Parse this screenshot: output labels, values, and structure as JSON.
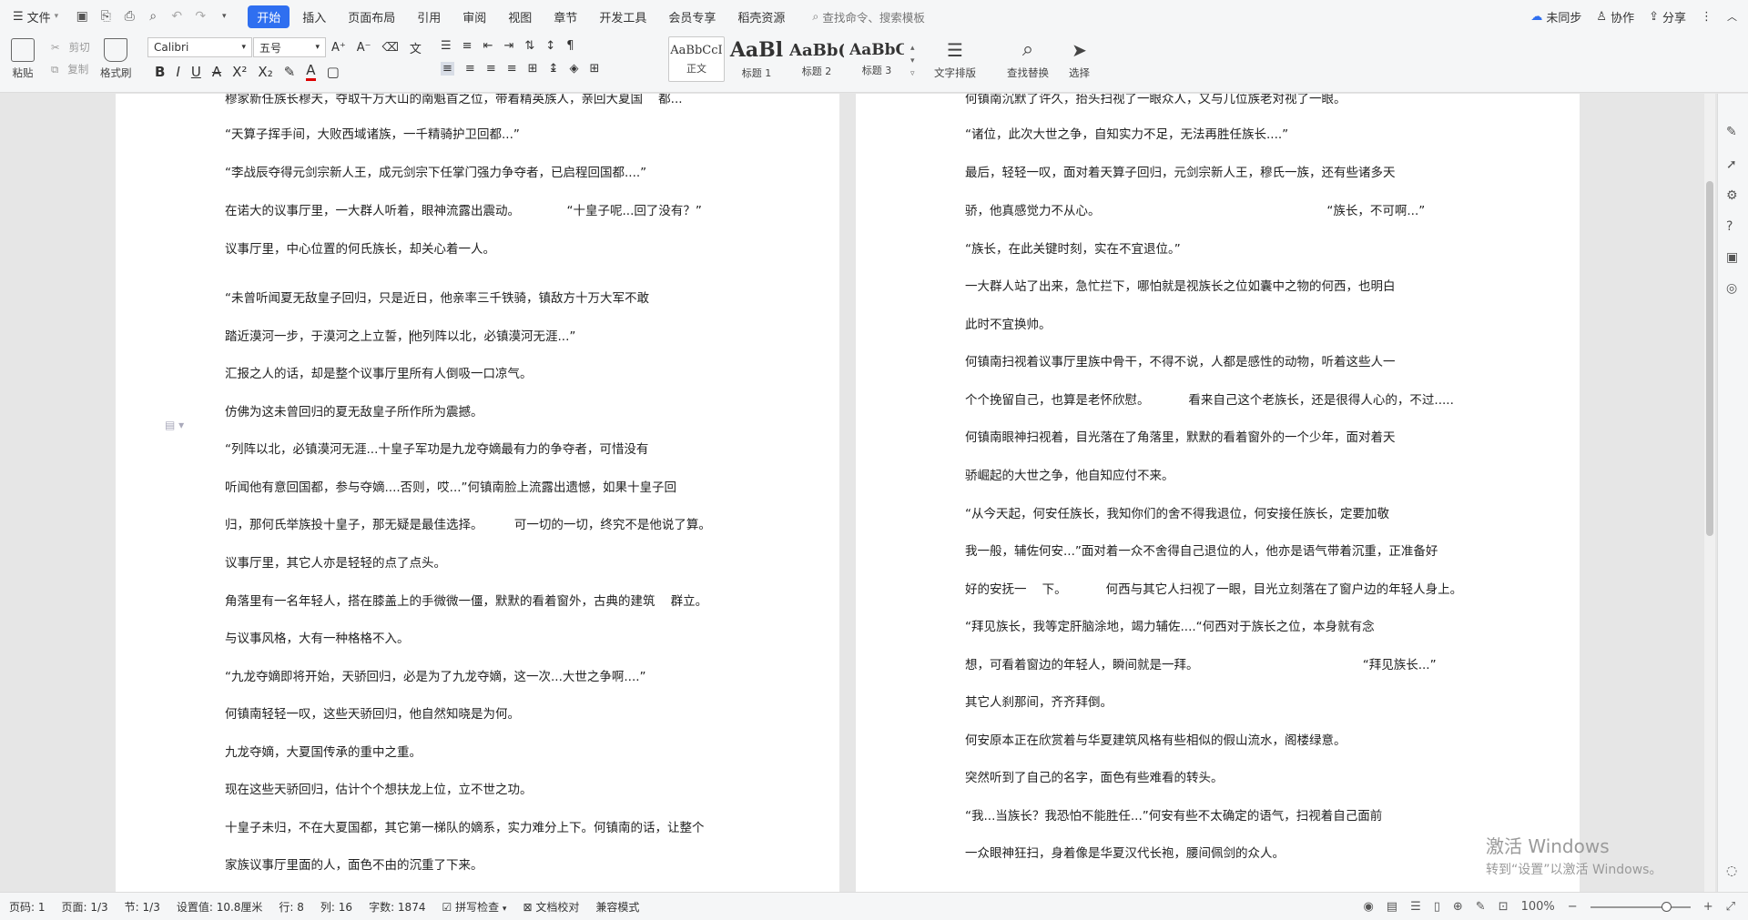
{
  "menubar": {
    "file_label": "文件",
    "tabs": [
      "开始",
      "插入",
      "页面布局",
      "引用",
      "审阅",
      "视图",
      "章节",
      "开发工具",
      "会员专享",
      "稻壳资源"
    ],
    "active_tab": "开始",
    "search_placeholder": "查找命令、搜索模板",
    "sync_label": "未同步",
    "collab_label": "协作",
    "share_label": "分享"
  },
  "ribbon": {
    "paste_label": "粘贴",
    "cut_label": "剪切",
    "copy_label": "复制",
    "format_painter_label": "格式刷",
    "font_name": "Calibri",
    "font_size": "五号",
    "styles": [
      {
        "preview": "AaBbCcI",
        "label": "正文"
      },
      {
        "preview": "AaBl",
        "label": "标题 1"
      },
      {
        "preview": "AaBb(",
        "label": "标题 2"
      },
      {
        "preview": "AaBbC",
        "label": "标题 3"
      }
    ],
    "text_layout_label": "文字排版",
    "find_replace_label": "查找替换",
    "select_label": "选择"
  },
  "page1_lines": [
    "穆家新任族长穆天，夺取千万大山的南魁首之位，带着精英族人，亲回大夏国    都...",
    "“天算子挥手间，大败西域诸族，一千精骑护卫回都...”",
    "“李战辰夺得元剑宗新人王，成元剑宗下任掌门强力争夺者，已启程回国都....”",
    "在诺大的议事厅里，一大群人听着，眼神流露出震动。            “十皇子呢...回了没有？”",
    "议事厅里，中心位置的何氏族长，却关心着一人。",
    "“未曾听闻夏无敌皇子回归，只是近日，他亲率三千铁骑，镇敌方十万大军不敢",
    "踏近漠河一步，于漠河之上立誓，",
    "他列阵以北，必镇漠河无涯...”",
    "汇报之人的话，却是整个议事厅里所有人倒吸一口凉气。",
    "仿佛为这未曾回归的夏无敌皇子所作所为震撼。",
    "“列阵以北，必镇漠河无涯...十皇子军功是九龙夺嫡最有力的争夺者，可惜没有",
    "听闻他有意回国都，参与夺嫡....否则，哎...”何镇南脸上流露出遗憾，如果十皇子回",
    "归，那何氏举族投十皇子，那无疑是最佳选择。        可一切的一切，终究不是他说了算。",
    "议事厅里，其它人亦是轻轻的点了点头。",
    "角落里有一名年轻人，搭在膝盖上的手微微一僵，默默的看着窗外，古典的建筑    群立。",
    "与议事风格，大有一种格格不入。",
    "“九龙夺嫡即将开始，天骄回归，必是为了九龙夺嫡，这一次...大世之争啊....”",
    "何镇南轻轻一叹，这些天骄回归，他自然知晓是为何。",
    "九龙夺嫡，大夏国传承的重中之重。",
    "现在这些天骄回归，估计个个想扶龙上位，立不世之功。",
    "十皇子未归，不在大夏国都，其它第一梯队的嫡系，实力难分上下。何镇南的话，让整个",
    "家族议事厅里面的人，面色不由的沉重了下来。"
  ],
  "page2_lines": [
    "何镇南沉默了许久，抬头扫视了一眼众人，又与几位族老对视了一眼。",
    "“诸位，此次大世之争，自知实力不足，无法再胜任族长....”",
    "最后，轻轻一叹，面对着天算子回归，元剑宗新人王，穆氏一族，还有些诸多天",
    "骄，他真感觉力不从心。                                                          “族长，不可啊...”",
    "“族长，在此关键时刻，实在不宜退位。”",
    "一大群人站了出来，急忙拦下，哪怕就是视族长之位如囊中之物的何西，也明白",
    "此时不宜换帅。",
    "何镇南扫视着议事厅里族中骨干，不得不说，人都是感性的动物，听着这些人一",
    "个个挽留自己，也算是老怀欣慰。          看来自己这个老族长，还是很得人心的，不过.....",
    "何镇南眼神扫视着，目光落在了角落里，默默的看着窗外的一个少年，面对着天",
    "骄崛起的大世之争，他自知应付不来。",
    "“从今天起，何安任族长，我知你们的舍不得我退位，何安接任族长，定要加敬",
    "我一般，辅佐何安...”面对着一众不舍得自己退位的人，他亦是语气带着沉重，正准备好",
    "好的安抚一    下。          何西与其它人扫视了一眼，目光立刻落在了窗户边的年轻人身上。",
    "“拜见族长，我等定肝脑涂地，竭力辅佐....“何西对于族长之位，本身就有念",
    "想，可看着窗边的年轻人，瞬间就是一拜。                                          “拜见族长...”",
    "其它人刹那间，齐齐拜倒。",
    "何安原本正在欣赏着与华夏建筑风格有些相似的假山流水，阁楼绿意。",
    "突然听到了自己的名字，面色有些难看的转头。",
    "“我...当族长？我恐怕不能胜任...”何安有些不太确定的语气，扫视着自己面前",
    "一众眼神狂扫，身着像是华夏汉代长袍，腰间佩剑的众人。"
  ],
  "watermark": {
    "line1": "激活 Windows",
    "line2": "转到“设置”以激活 Windows。"
  },
  "status": {
    "page_code": "页码: 1",
    "pages": "页面: 1/3",
    "section": "节: 1/3",
    "setting": "设置值: 10.8厘米",
    "row": "行: 8",
    "col": "列: 16",
    "words": "字数: 1874",
    "spell_check": "拼写检查",
    "doc_proof": "文档校对",
    "compat_mode": "兼容模式",
    "zoom": "100%"
  }
}
